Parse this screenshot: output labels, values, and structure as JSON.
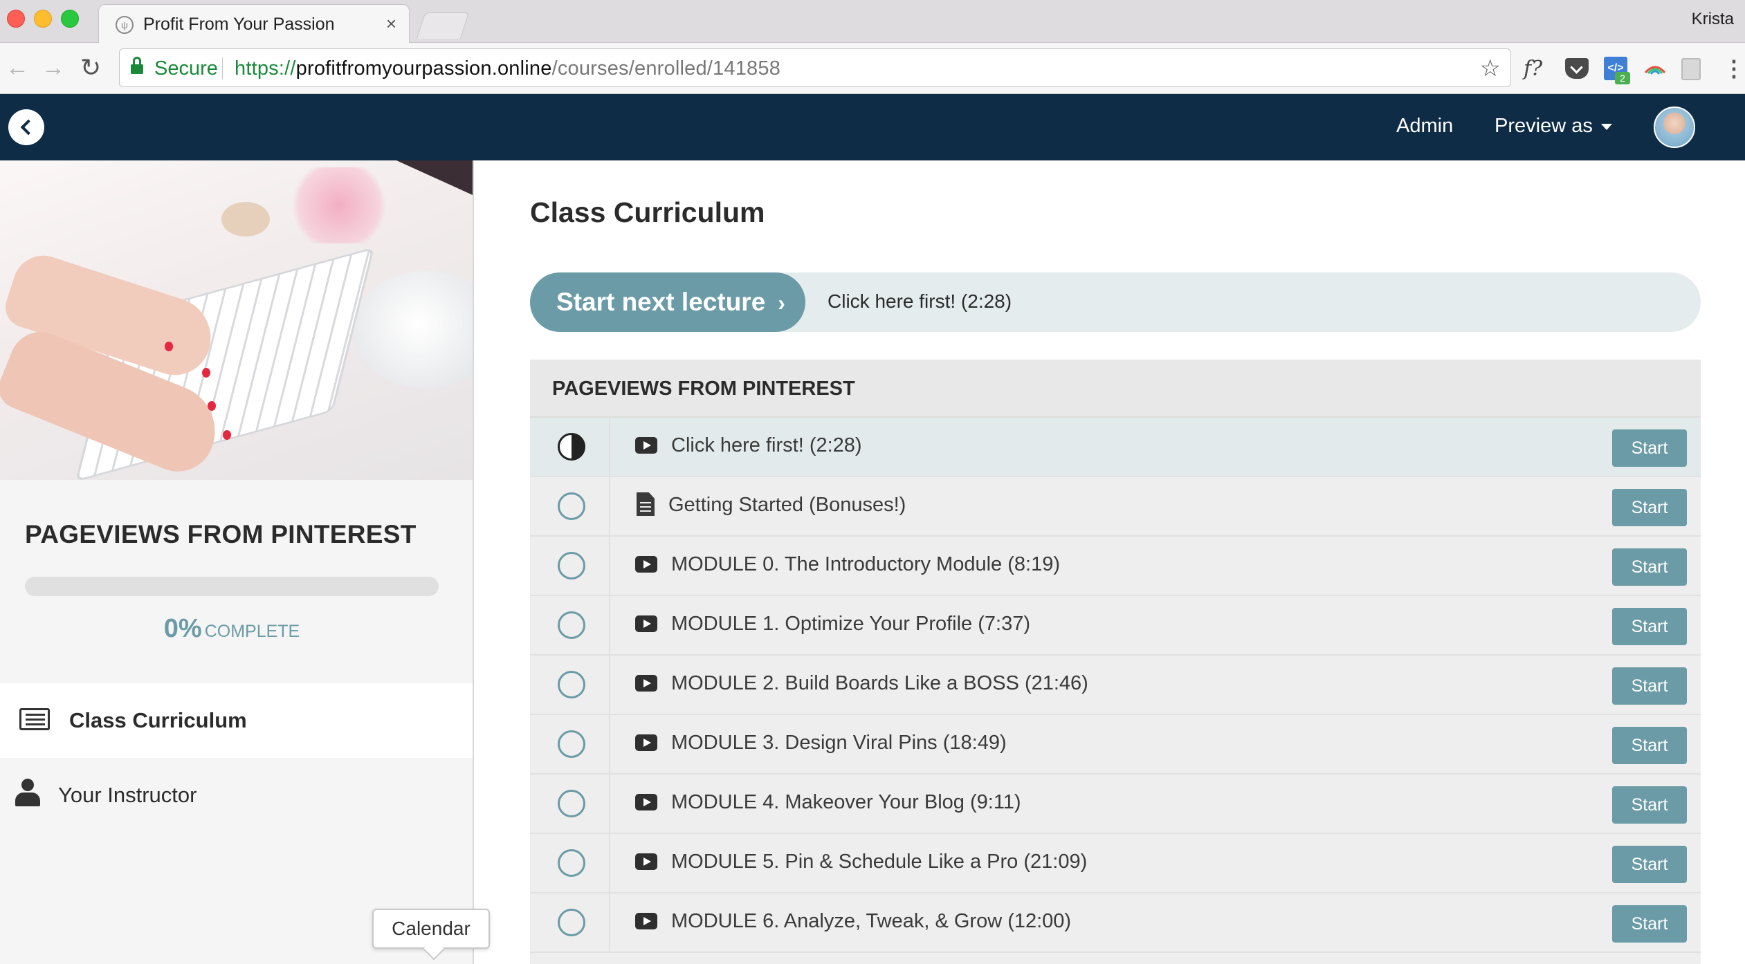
{
  "browser": {
    "tab_title": "Profit From Your Passion",
    "tab_close": "×",
    "profile_name": "Krista",
    "secure_label": "Secure",
    "url_scheme": "https://",
    "url_host": "profitfromyourpassion.online",
    "url_path": "/courses/enrolled/141858",
    "ext_fq": "f?",
    "ext_code": "</>",
    "ext_code_badge": "2"
  },
  "header": {
    "admin_label": "Admin",
    "preview_label": "Preview as"
  },
  "sidebar": {
    "course_title": "PAGEVIEWS FROM PINTEREST",
    "progress_value": 0,
    "progress_pct": "0%",
    "progress_word": "COMPLETE",
    "nav": [
      {
        "label": "Class Curriculum",
        "icon": "list-icon",
        "active": true
      },
      {
        "label": "Your Instructor",
        "icon": "user-icon",
        "active": false
      }
    ],
    "tooltip": "Calendar"
  },
  "main": {
    "title": "Class Curriculum",
    "next_button_label": "Start next lecture",
    "next_button_arrow": "›",
    "next_lecture": "Click here first! (2:28)",
    "section_title": "PAGEVIEWS FROM PINTEREST",
    "lectures": [
      {
        "title": "Click here first! (2:28)",
        "type": "video",
        "status": "in-progress",
        "button": "Start"
      },
      {
        "title": "Getting Started (Bonuses!)",
        "type": "document",
        "status": "not-started",
        "button": "Start"
      },
      {
        "title": "MODULE 0. The Introductory Module (8:19)",
        "type": "video",
        "status": "not-started",
        "button": "Start"
      },
      {
        "title": "MODULE 1. Optimize Your Profile (7:37)",
        "type": "video",
        "status": "not-started",
        "button": "Start"
      },
      {
        "title": "MODULE 2. Build Boards Like a BOSS (21:46)",
        "type": "video",
        "status": "not-started",
        "button": "Start"
      },
      {
        "title": "MODULE 3. Design Viral Pins (18:49)",
        "type": "video",
        "status": "not-started",
        "button": "Start"
      },
      {
        "title": "MODULE 4. Makeover Your Blog (9:11)",
        "type": "video",
        "status": "not-started",
        "button": "Start"
      },
      {
        "title": "MODULE 5. Pin & Schedule Like a Pro (21:09)",
        "type": "video",
        "status": "not-started",
        "button": "Start"
      },
      {
        "title": "MODULE 6. Analyze, Tweak, & Grow (12:00)",
        "type": "video",
        "status": "not-started",
        "button": "Start"
      }
    ]
  },
  "colors": {
    "header_bg": "#0f2c47",
    "accent": "#6b9ba6",
    "secure_green": "#1a8a3a"
  }
}
